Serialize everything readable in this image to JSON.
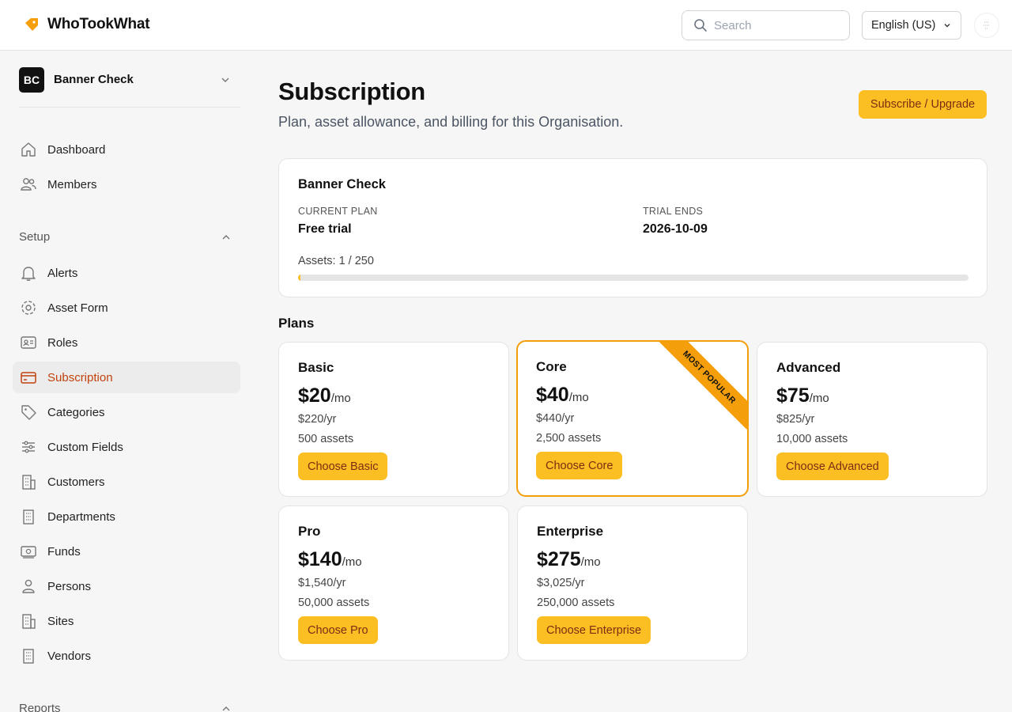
{
  "header": {
    "brand": "WhoTookWhat",
    "search_placeholder": "Search",
    "language": "English (US)"
  },
  "sidebar": {
    "org": {
      "initials": "BC",
      "name": "Banner Check"
    },
    "top_items": [
      {
        "label": "Dashboard",
        "icon": "home-icon"
      },
      {
        "label": "Members",
        "icon": "users-icon"
      }
    ],
    "setup_label": "Setup",
    "setup_items": [
      {
        "label": "Alerts",
        "icon": "bell-icon"
      },
      {
        "label": "Asset Form",
        "icon": "gear-icon"
      },
      {
        "label": "Roles",
        "icon": "id-card-icon"
      },
      {
        "label": "Subscription",
        "icon": "credit-card-icon",
        "active": true
      },
      {
        "label": "Categories",
        "icon": "tag-icon"
      },
      {
        "label": "Custom Fields",
        "icon": "sliders-icon"
      },
      {
        "label": "Customers",
        "icon": "building-icon"
      },
      {
        "label": "Departments",
        "icon": "building-icon"
      },
      {
        "label": "Funds",
        "icon": "banknote-icon"
      },
      {
        "label": "Persons",
        "icon": "person-icon"
      },
      {
        "label": "Sites",
        "icon": "building-icon"
      },
      {
        "label": "Vendors",
        "icon": "building-icon"
      }
    ],
    "reports_label": "Reports"
  },
  "main": {
    "title": "Subscription",
    "subtitle": "Plan, asset allowance, and billing for this Organisation.",
    "primary_button": "Subscribe / Upgrade",
    "summary": {
      "org_name": "Banner Check",
      "current_plan_label": "CURRENT PLAN",
      "current_plan": "Free trial",
      "trial_ends_label": "TRIAL ENDS",
      "trial_ends": "2026-10-09",
      "assets_text": "Assets: 1 / 250",
      "assets_used": 1,
      "assets_limit": 250
    },
    "plans_heading": "Plans",
    "plans": [
      {
        "name": "Basic",
        "price": "$20",
        "per": "/mo",
        "yearly": "$220/yr",
        "assets": "500 assets",
        "button": "Choose Basic"
      },
      {
        "name": "Core",
        "price": "$40",
        "per": "/mo",
        "yearly": "$440/yr",
        "assets": "2,500 assets",
        "button": "Choose Core",
        "ribbon": "MOST POPULAR"
      },
      {
        "name": "Advanced",
        "price": "$75",
        "per": "/mo",
        "yearly": "$825/yr",
        "assets": "10,000 assets",
        "button": "Choose Advanced"
      },
      {
        "name": "Pro",
        "price": "$140",
        "per": "/mo",
        "yearly": "$1,540/yr",
        "assets": "50,000 assets",
        "button": "Choose Pro"
      },
      {
        "name": "Enterprise",
        "price": "$275",
        "per": "/mo",
        "yearly": "$3,025/yr",
        "assets": "250,000 assets",
        "button": "Choose Enterprise"
      }
    ]
  },
  "colors": {
    "accent": "#fbbf24",
    "accent_border": "#f59e0b",
    "active_nav_text": "#c2410c",
    "button_text": "#7c2d12"
  }
}
